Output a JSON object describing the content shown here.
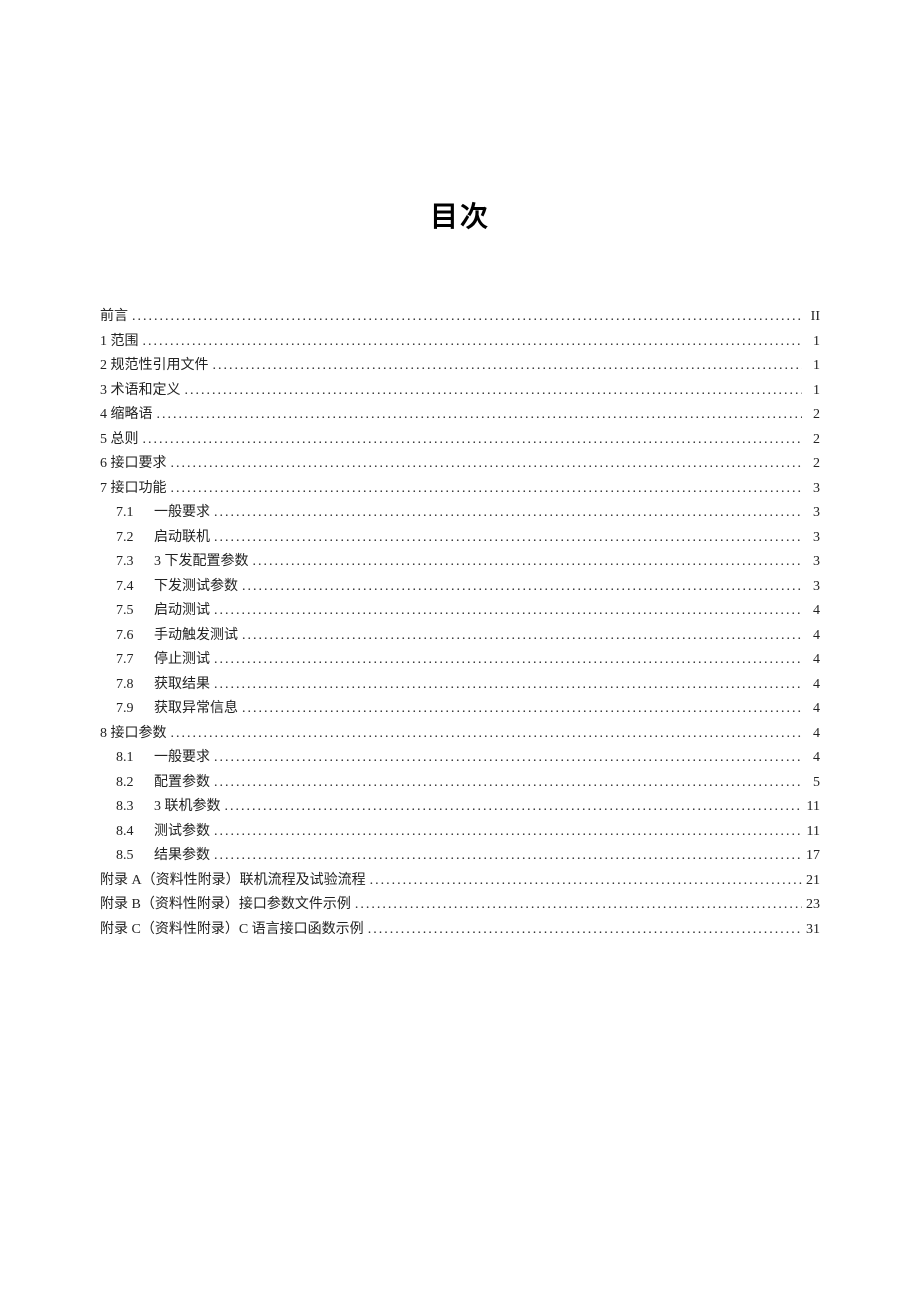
{
  "title": "目次",
  "entries": [
    {
      "type": "top",
      "label": "前言",
      "page": "II"
    },
    {
      "type": "top",
      "label": "1 范围",
      "page": "1"
    },
    {
      "type": "top",
      "label": "2 规范性引用文件",
      "page": "1"
    },
    {
      "type": "top",
      "label": "3 术语和定义",
      "page": "1"
    },
    {
      "type": "top",
      "label": "4 缩略语",
      "page": "2"
    },
    {
      "type": "top",
      "label": "5 总则",
      "page": "2"
    },
    {
      "type": "top",
      "label": "6 接口要求",
      "page": "2"
    },
    {
      "type": "top",
      "label": "7 接口功能",
      "page": "3"
    },
    {
      "type": "sub",
      "num": "7.1",
      "label": "一般要求",
      "page": "3"
    },
    {
      "type": "sub",
      "num": "7.2",
      "label": "启动联机",
      "page": "3"
    },
    {
      "type": "sub",
      "num": "7.3",
      "label": "3 下发配置参数",
      "page": "3"
    },
    {
      "type": "sub",
      "num": "7.4",
      "label": "下发测试参数",
      "page": "3"
    },
    {
      "type": "sub",
      "num": "7.5",
      "label": "启动测试",
      "page": "4"
    },
    {
      "type": "sub",
      "num": "7.6",
      "label": "手动触发测试",
      "page": "4"
    },
    {
      "type": "sub",
      "num": "7.7",
      "label": "停止测试",
      "page": "4"
    },
    {
      "type": "sub",
      "num": "7.8",
      "label": "获取结果",
      "page": "4"
    },
    {
      "type": "sub",
      "num": "7.9",
      "label": "获取异常信息",
      "page": "4"
    },
    {
      "type": "top",
      "label": "8 接口参数",
      "page": "4"
    },
    {
      "type": "sub",
      "num": "8.1",
      "label": "一般要求",
      "page": "4"
    },
    {
      "type": "sub",
      "num": "8.2",
      "label": "配置参数",
      "page": "5"
    },
    {
      "type": "sub",
      "num": "8.3",
      "label": "3 联机参数",
      "page": "11"
    },
    {
      "type": "sub",
      "num": "8.4",
      "label": "测试参数",
      "page": "11"
    },
    {
      "type": "sub",
      "num": "8.5",
      "label": "结果参数",
      "page": "17"
    },
    {
      "type": "top",
      "label": "附录 A（资料性附录）联机流程及试验流程",
      "page": "21"
    },
    {
      "type": "top",
      "label": "附录 B（资料性附录）接口参数文件示例",
      "page": "23"
    },
    {
      "type": "top",
      "label": "附录 C（资料性附录）C 语言接口函数示例",
      "page": "31"
    }
  ]
}
